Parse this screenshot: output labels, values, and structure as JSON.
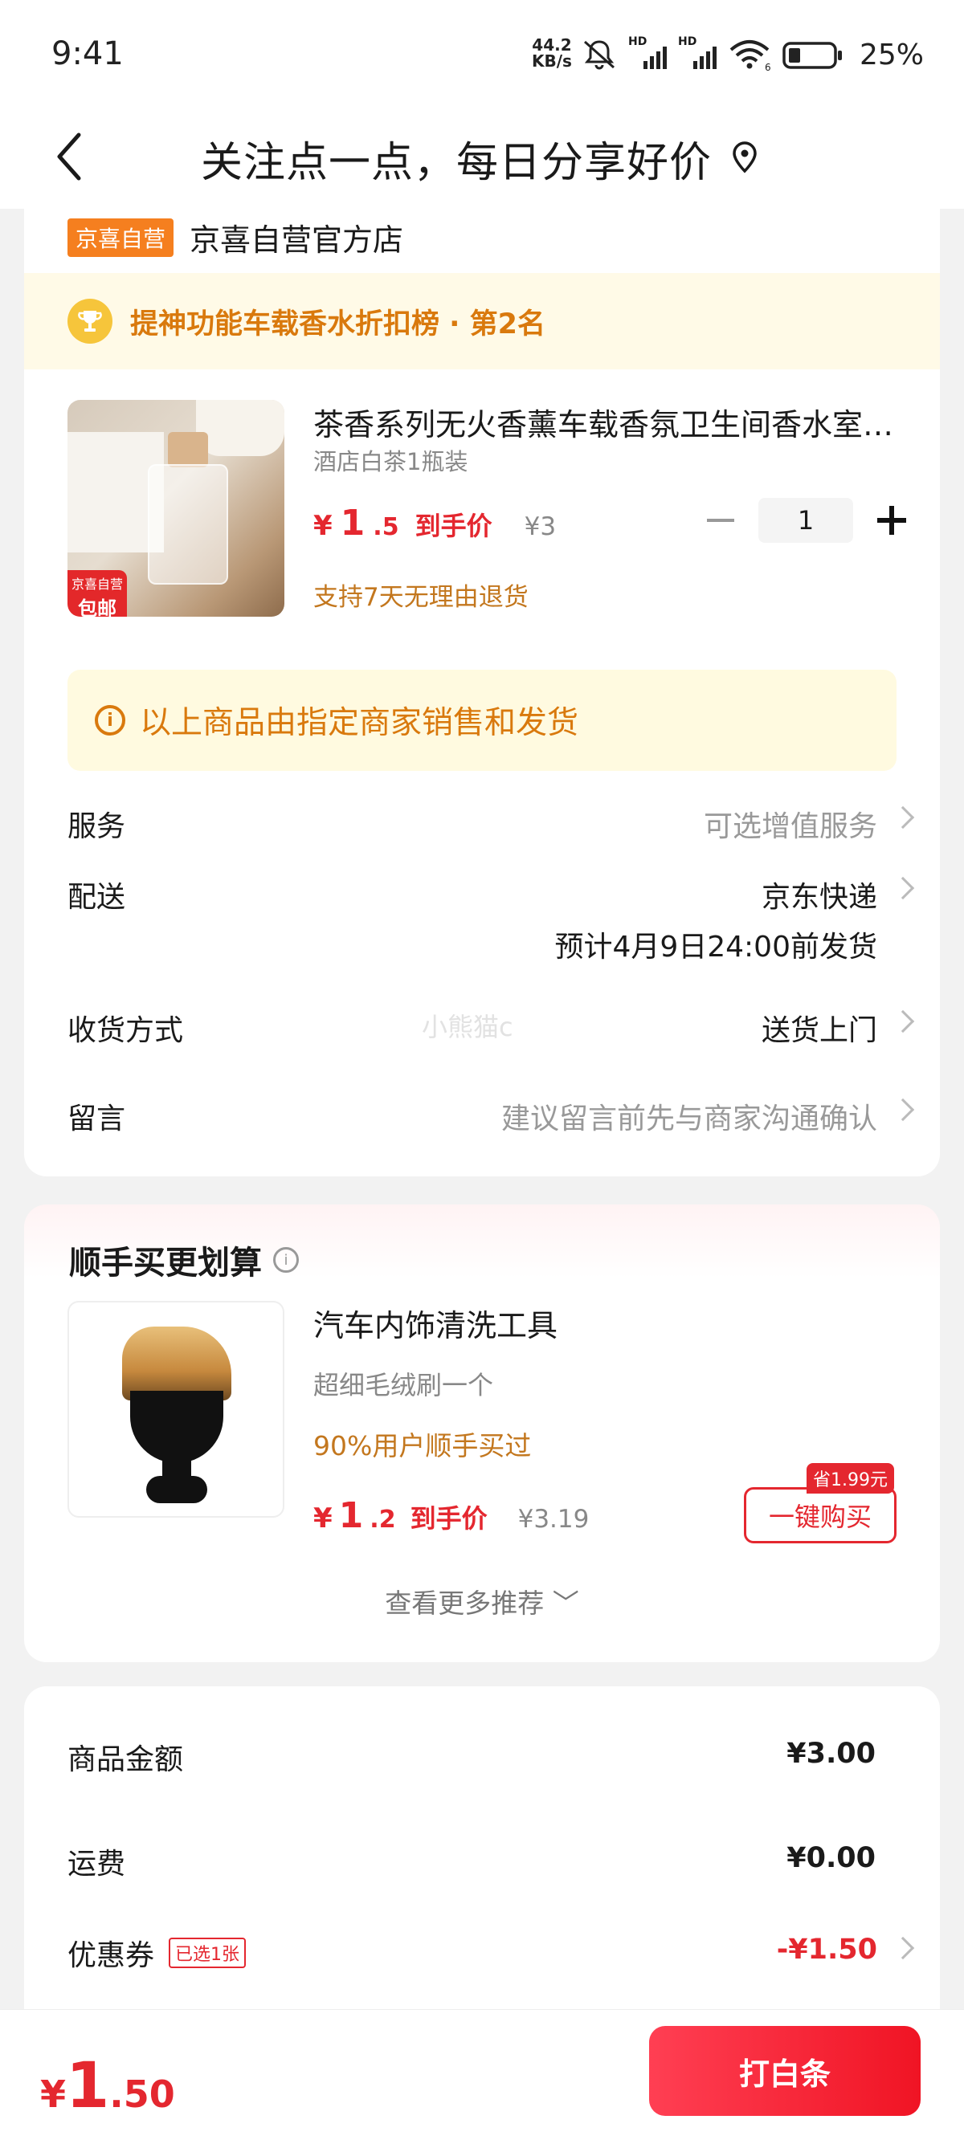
{
  "status": {
    "time": "9:41",
    "net_speed": "44.2",
    "net_unit": "KB/s",
    "hd1": "HD",
    "hd2": "HD",
    "wifi_num": "6",
    "battery": "25%"
  },
  "header": {
    "title": "关注点一点，每日分享好价"
  },
  "shop": {
    "tag": "京喜自营",
    "name": "京喜自营官方店"
  },
  "rank": {
    "text": "提神功能车载香水折扣榜 · 第2名"
  },
  "product": {
    "name": "茶香系列无火香薰车载香氛卫生间香水室内持久",
    "spec": "酒店白茶1瓶装",
    "price_currency": "¥",
    "price_int": "1",
    "price_dec": ".5",
    "price_label": "到手价",
    "orig_price": "¥3",
    "qty": "1",
    "return_policy": "支持7天无理由退货",
    "badge_line1": "京喜自营",
    "badge_line2": "包邮"
  },
  "notice": {
    "icon": "i",
    "text": "以上商品由指定商家销售和发货"
  },
  "rows": {
    "service": {
      "label": "服务",
      "value": "可选增值服务"
    },
    "delivery": {
      "label": "配送",
      "value": "京东快递",
      "sub": "预计4月9日24:00前发货"
    },
    "receive": {
      "label": "收货方式",
      "value": "送货上门"
    },
    "message": {
      "label": "留言",
      "value": "建议留言前先与商家沟通确认"
    }
  },
  "watermark": "小熊猫c",
  "upsell": {
    "title": "顺手买更划算",
    "help_icon": "i",
    "name": "汽车内饰清洗工具",
    "spec": "超细毛绒刷一个",
    "popularity": "90%用户顺手买过",
    "price_currency": "¥",
    "price_int": "1",
    "price_dec": ".2",
    "price_label": "到手价",
    "orig_price": "¥3.19",
    "save_tag": "省1.99元",
    "buy_label": "一键购买",
    "more_label": "查看更多推荐 ﹀"
  },
  "summary": {
    "goods": {
      "label": "商品金额",
      "value": "¥3.00"
    },
    "shipping": {
      "label": "运费",
      "value": "¥0.00"
    },
    "coupon": {
      "label": "优惠券",
      "tag": "已选1张",
      "value": "-¥1.50"
    }
  },
  "bottom": {
    "currency": "¥",
    "total_int": "1",
    "total_dec": ".50",
    "pay_label": "打白条"
  },
  "colors": {
    "accent_red": "#e4272f",
    "warning_orange": "#d9790d",
    "brand_orange": "#f57f1f"
  }
}
